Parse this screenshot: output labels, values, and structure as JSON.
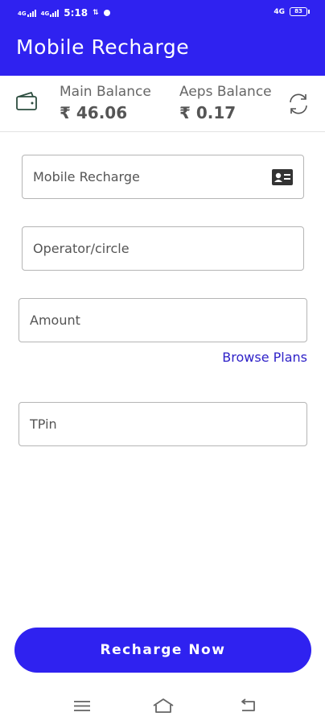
{
  "status_bar": {
    "network_1": "4G",
    "network_2": "4G",
    "time": "5:18",
    "extra": "4G",
    "battery": "83"
  },
  "app_bar": {
    "title": "Mobile Recharge"
  },
  "balances": {
    "main_label": "Main Balance",
    "main_value": "₹ 46.06",
    "aeps_label": "Aeps Balance",
    "aeps_value": "₹ 0.17"
  },
  "form": {
    "mobile_placeholder": "Mobile Recharge",
    "operator_placeholder": "Operator/circle",
    "amount_placeholder": "Amount",
    "browse_plans": "Browse Plans",
    "tpin_placeholder": "TPin"
  },
  "actions": {
    "recharge_now": "Recharge Now"
  },
  "colors": {
    "primary": "#2f22f0",
    "link": "#2f22c8"
  },
  "icons": [
    "wallet-icon",
    "refresh-icon",
    "contact-card-icon",
    "menu-icon",
    "home-icon",
    "back-icon"
  ]
}
